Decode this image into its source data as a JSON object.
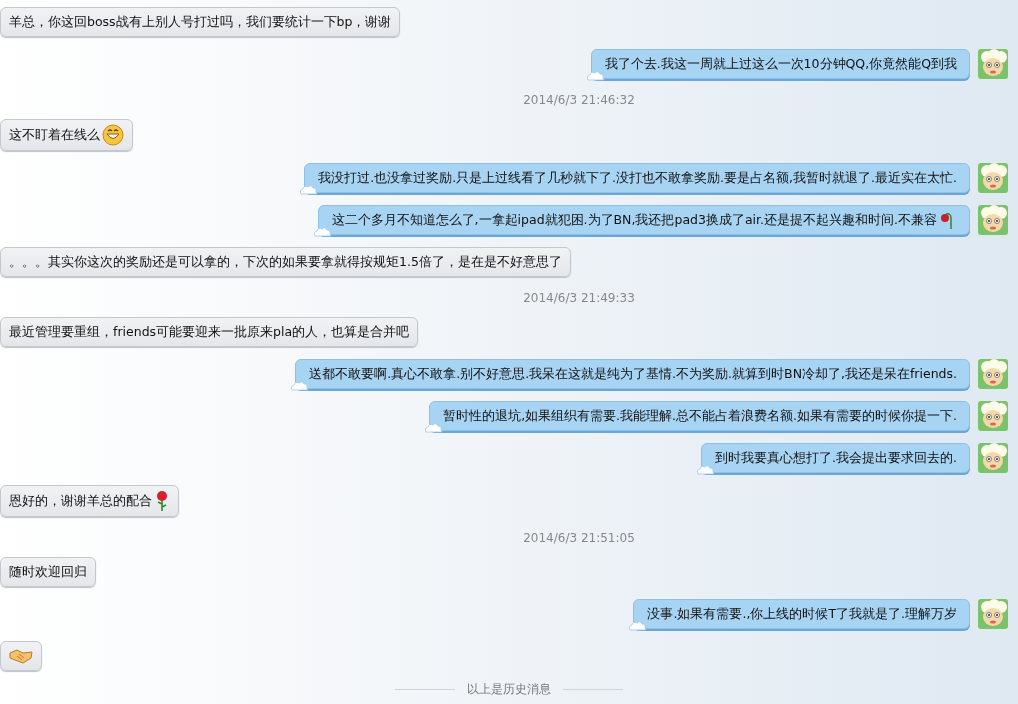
{
  "messages": [
    {
      "kind": "incoming",
      "text": "羊总，你这回boss战有上别人号打过吗，我们要统计一下bp，谢谢"
    },
    {
      "kind": "outgoing",
      "text": "我了个去.我这一周就上过这么一次10分钟QQ,你竟然能Q到我"
    },
    {
      "kind": "time",
      "text": "2014/6/3 21:46:32"
    },
    {
      "kind": "incoming",
      "text": "这不盯着在线么",
      "sticker": {
        "kind": "grin"
      }
    },
    {
      "kind": "outgoing",
      "text": "我没打过.也没拿过奖励.只是上过线看了几秒就下了.没打也不敢拿奖励.要是占名额,我暂时就退了.最近实在太忙."
    },
    {
      "kind": "outgoing",
      "text": "这二个多月不知道怎么了,一拿起ipad就犯困.为了BN,我还把pad3换成了air.还是提不起兴趣和时间.不兼容",
      "sticker": {
        "kind": "wilted-rose"
      }
    },
    {
      "kind": "incoming",
      "text": "。。。其实你这次的奖励还是可以拿的，下次的如果要拿就得按规矩1.5倍了，是在是不好意思了"
    },
    {
      "kind": "time",
      "text": "2014/6/3 21:49:33"
    },
    {
      "kind": "incoming",
      "text": "最近管理要重组，friends可能要迎来一批原来pla的人，也算是合并吧"
    },
    {
      "kind": "outgoing",
      "text": "送都不敢要啊.真心不敢拿.别不好意思.我呆在这就是纯为了基情.不为奖励.就算到时BN冷却了,我还是呆在friends."
    },
    {
      "kind": "outgoing",
      "text": "暂时性的退坑,如果组织有需要.我能理解.总不能占着浪费名额.如果有需要的时候你提一下."
    },
    {
      "kind": "outgoing",
      "text": "到时我要真心想打了.我会提出要求回去的."
    },
    {
      "kind": "incoming",
      "text": "恩好的，谢谢羊总的配合",
      "sticker": {
        "kind": "rose"
      }
    },
    {
      "kind": "time",
      "text": "2014/6/3 21:51:05"
    },
    {
      "kind": "incoming",
      "text": "随时欢迎回归"
    },
    {
      "kind": "outgoing",
      "text": "没事.如果有需要.,你上线的时候T了我就是了.理解万岁"
    },
    {
      "kind": "incoming",
      "sticker": {
        "kind": "handshake"
      }
    }
  ],
  "history_divider": "以上是历史消息"
}
